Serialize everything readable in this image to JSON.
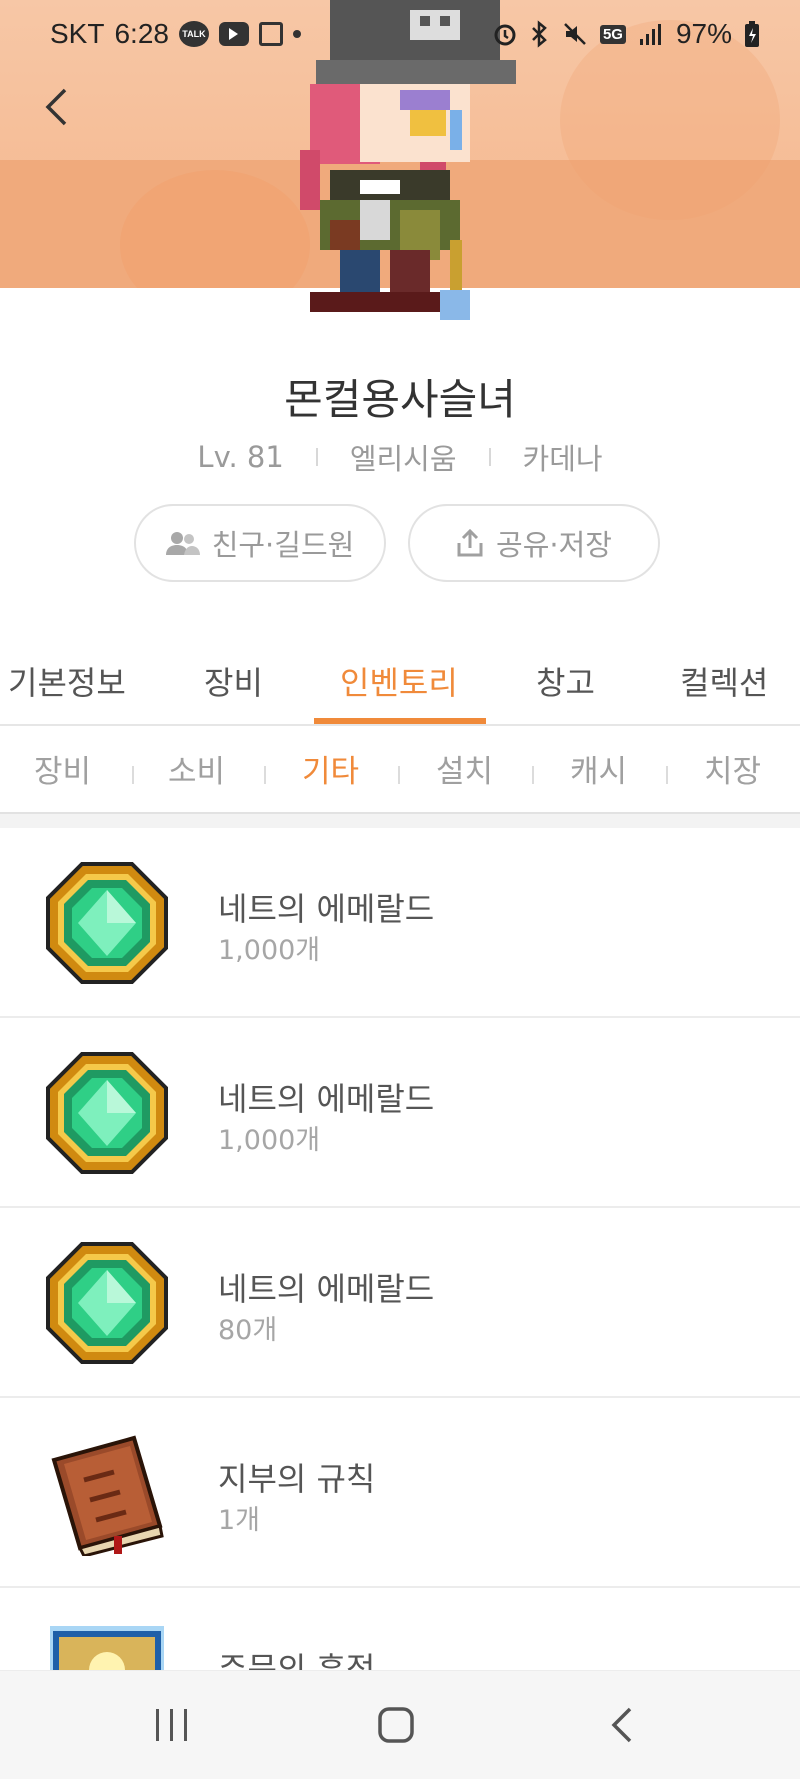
{
  "status_bar": {
    "carrier": "SKT",
    "time": "6:28",
    "battery": "97%",
    "network": "5G",
    "left_icons": [
      "kakaotalk-icon",
      "youtube-icon",
      "gallery-icon",
      "dot-icon"
    ],
    "right_icons": [
      "alarm-icon",
      "bluetooth-icon",
      "mute-icon",
      "5g-icon",
      "signal-icon",
      "battery-icon"
    ]
  },
  "profile": {
    "name": "몬컬용사슬녀",
    "level": "Lv. 81",
    "world": "엘리시움",
    "job": "카데나"
  },
  "actions": {
    "friends_label": "친구·길드원",
    "share_label": "공유·저장"
  },
  "tabs": [
    {
      "label": "기본정보",
      "active": false
    },
    {
      "label": "장비",
      "active": false
    },
    {
      "label": "인벤토리",
      "active": true
    },
    {
      "label": "창고",
      "active": false
    },
    {
      "label": "컬렉션",
      "active": false
    }
  ],
  "subtabs": [
    {
      "label": "장비",
      "active": false
    },
    {
      "label": "소비",
      "active": false
    },
    {
      "label": "기타",
      "active": true
    },
    {
      "label": "설치",
      "active": false
    },
    {
      "label": "캐시",
      "active": false
    },
    {
      "label": "치장",
      "active": false
    }
  ],
  "items": [
    {
      "name": "네트의 에메랄드",
      "count": "1,000개",
      "icon": "emerald-icon"
    },
    {
      "name": "네트의 에메랄드",
      "count": "1,000개",
      "icon": "emerald-icon"
    },
    {
      "name": "네트의 에메랄드",
      "count": "80개",
      "icon": "emerald-icon"
    },
    {
      "name": "지부의 규칙",
      "count": "1개",
      "icon": "book-icon"
    },
    {
      "name": "주문의 흔적",
      "count": "",
      "icon": "scroll-icon"
    }
  ],
  "colors": {
    "accent": "#f08a3a",
    "banner": "#f4b68c"
  }
}
